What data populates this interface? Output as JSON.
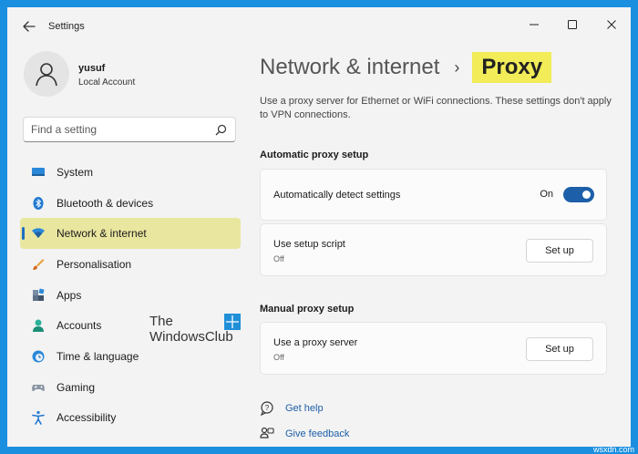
{
  "window": {
    "title": "Settings"
  },
  "profile": {
    "name": "yusuf",
    "account_type": "Local Account"
  },
  "search": {
    "placeholder": "Find a setting"
  },
  "sidebar": {
    "items": [
      {
        "label": "System",
        "icon": "system-icon",
        "selected": false
      },
      {
        "label": "Bluetooth & devices",
        "icon": "bluetooth-icon",
        "selected": false
      },
      {
        "label": "Network & internet",
        "icon": "wifi-icon",
        "selected": true
      },
      {
        "label": "Personalisation",
        "icon": "brush-icon",
        "selected": false
      },
      {
        "label": "Apps",
        "icon": "apps-icon",
        "selected": false
      },
      {
        "label": "Accounts",
        "icon": "accounts-icon",
        "selected": false
      },
      {
        "label": "Time & language",
        "icon": "globe-clock-icon",
        "selected": false
      },
      {
        "label": "Gaming",
        "icon": "gamepad-icon",
        "selected": false
      },
      {
        "label": "Accessibility",
        "icon": "accessibility-icon",
        "selected": false
      }
    ]
  },
  "watermark": {
    "line1": "The",
    "line2": "WindowsClub"
  },
  "breadcrumb": {
    "parent": "Network & internet",
    "separator": "›",
    "current": "Proxy"
  },
  "description": "Use a proxy server for Ethernet or WiFi connections. These settings don't apply to VPN connections.",
  "automatic": {
    "heading": "Automatic proxy setup",
    "detect": {
      "title": "Automatically detect settings",
      "state_label": "On",
      "enabled": true
    },
    "script": {
      "title": "Use setup script",
      "status": "Off",
      "button": "Set up"
    }
  },
  "manual": {
    "heading": "Manual proxy setup",
    "server": {
      "title": "Use a proxy server",
      "status": "Off",
      "button": "Set up"
    }
  },
  "help": {
    "get_help": "Get help",
    "give_feedback": "Give feedback"
  },
  "site_mark": "wsxdn.com",
  "colors": {
    "accent": "#1d5fa8",
    "highlight": "#f1ec57",
    "frame": "#1a8fe0"
  }
}
